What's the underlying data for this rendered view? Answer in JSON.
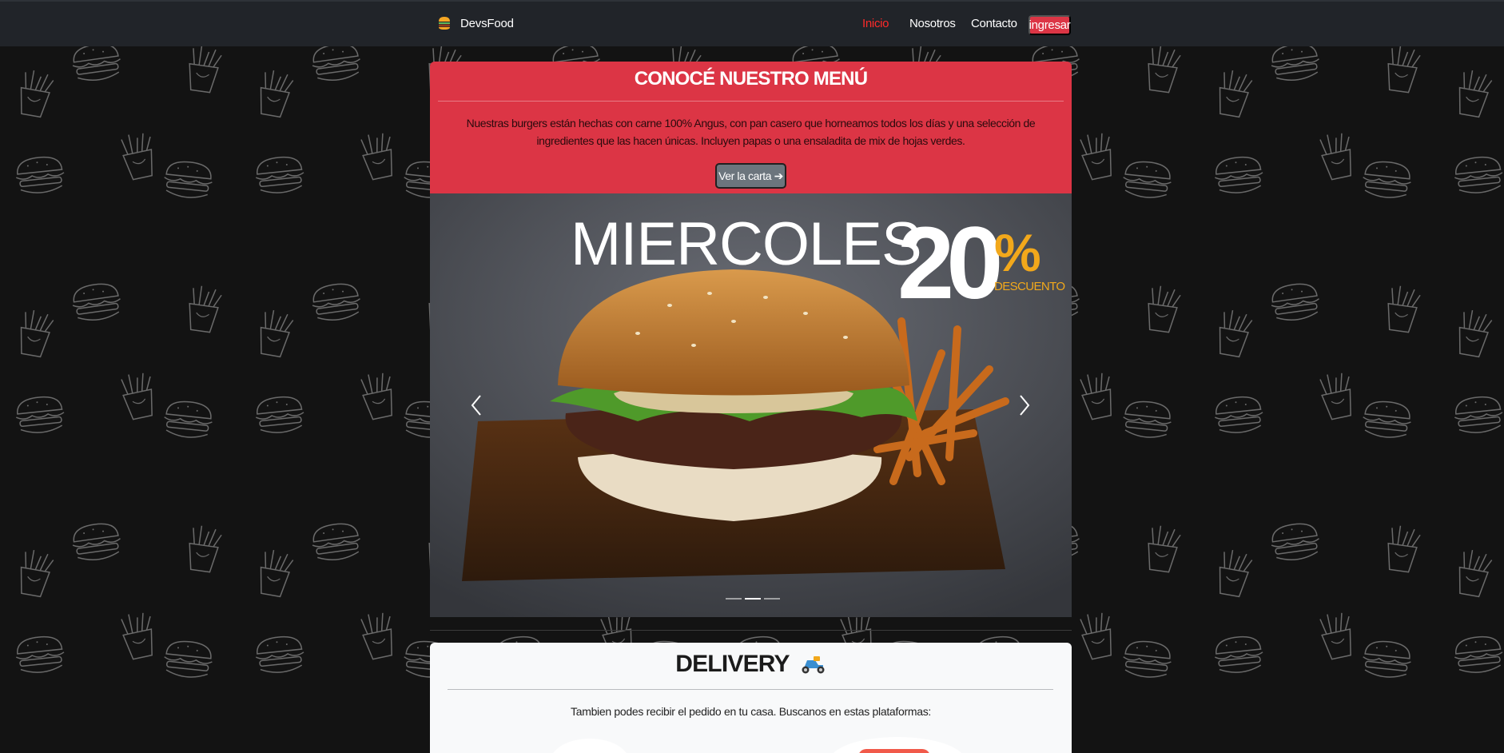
{
  "navbar": {
    "brand": "DevsFood",
    "links": [
      {
        "label": "Inicio",
        "active": true
      },
      {
        "label": "Nosotros",
        "active": false
      },
      {
        "label": "Contacto",
        "active": false
      }
    ],
    "login_label": "ingresar"
  },
  "menu": {
    "title": "CONOCÉ NUESTRO MENÚ",
    "description": "Nuestras burgers están hechas con carne 100% Angus, con pan casero que horneamos todos los días y una selección de ingredientes que las hacen únicas. Incluyen papas o una ensaladita de mix de hojas verdes.",
    "button_label": "Ver la carta ➔"
  },
  "carousel": {
    "promo_day": "MIERCOLES",
    "promo_number": "20",
    "promo_sign": "%",
    "promo_label": "DESCUENTO",
    "slide_count": 3,
    "active_slide": 1
  },
  "delivery": {
    "title": "DELIVERY",
    "icon": "scooter-icon",
    "text": "Tambien podes recibir el pedido en tu casa. Buscanos en estas plataformas:"
  },
  "colors": {
    "accent": "#dc3545",
    "nav_bg": "#212429",
    "page_bg": "#131313",
    "promo_yellow": "#f2a81b",
    "active_link": "#ff2a2a"
  }
}
